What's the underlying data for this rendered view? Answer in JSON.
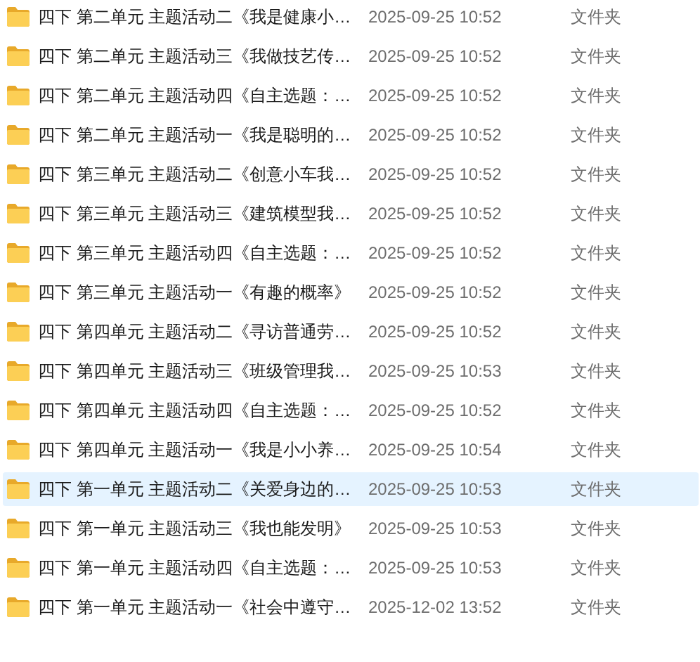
{
  "files": [
    {
      "name": "四下 第二单元 主题活动二《我是健康小…",
      "modified": "2025-09-25 10:52",
      "type": "文件夹",
      "selected": false
    },
    {
      "name": "四下 第二单元 主题活动三《我做技艺传…",
      "modified": "2025-09-25 10:52",
      "type": "文件夹",
      "selected": false
    },
    {
      "name": "四下 第二单元 主题活动四《自主选题：…",
      "modified": "2025-09-25 10:52",
      "type": "文件夹",
      "selected": false
    },
    {
      "name": "四下 第二单元 主题活动一《我是聪明的…",
      "modified": "2025-09-25 10:52",
      "type": "文件夹",
      "selected": false
    },
    {
      "name": "四下 第三单元 主题活动二《创意小车我…",
      "modified": "2025-09-25 10:52",
      "type": "文件夹",
      "selected": false
    },
    {
      "name": "四下 第三单元 主题活动三《建筑模型我…",
      "modified": "2025-09-25 10:52",
      "type": "文件夹",
      "selected": false
    },
    {
      "name": "四下 第三单元 主题活动四《自主选题：…",
      "modified": "2025-09-25 10:52",
      "type": "文件夹",
      "selected": false
    },
    {
      "name": "四下 第三单元 主题活动一《有趣的概率》",
      "modified": "2025-09-25 10:52",
      "type": "文件夹",
      "selected": false
    },
    {
      "name": "四下 第四单元 主题活动二《寻访普通劳…",
      "modified": "2025-09-25 10:52",
      "type": "文件夹",
      "selected": false
    },
    {
      "name": "四下 第四单元 主题活动三《班级管理我…",
      "modified": "2025-09-25 10:53",
      "type": "文件夹",
      "selected": false
    },
    {
      "name": "四下 第四单元 主题活动四《自主选题：…",
      "modified": "2025-09-25 10:52",
      "type": "文件夹",
      "selected": false
    },
    {
      "name": "四下 第四单元 主题活动一《我是小小养…",
      "modified": "2025-09-25 10:54",
      "type": "文件夹",
      "selected": false
    },
    {
      "name": "四下 第一单元 主题活动二《关爱身边的…",
      "modified": "2025-09-25 10:53",
      "type": "文件夹",
      "selected": true
    },
    {
      "name": "四下 第一单元 主题活动三《我也能发明》",
      "modified": "2025-09-25 10:53",
      "type": "文件夹",
      "selected": false
    },
    {
      "name": "四下 第一单元 主题活动四《自主选题：…",
      "modified": "2025-09-25 10:53",
      "type": "文件夹",
      "selected": false
    },
    {
      "name": "四下 第一单元 主题活动一《社会中遵守…",
      "modified": "2025-12-02 13:52",
      "type": "文件夹",
      "selected": false
    }
  ]
}
